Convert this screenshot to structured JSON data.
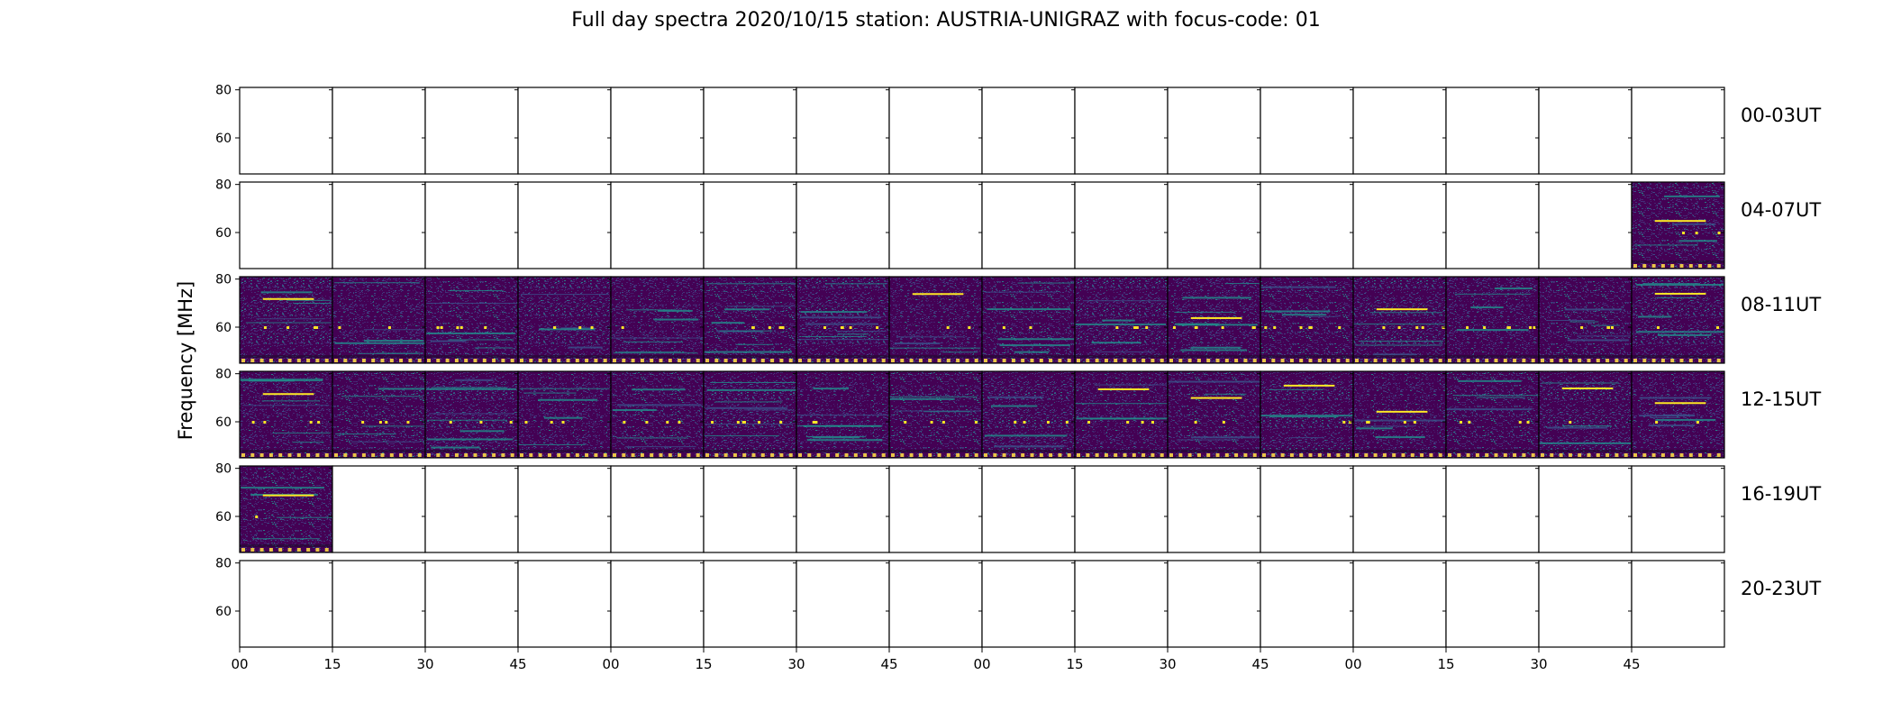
{
  "title": "Full day spectra 2020/10/15 station: AUSTRIA-UNIGRAZ with focus-code: 01",
  "colors": {
    "background": "#440154",
    "mid": "#3b528b",
    "teal": "#21918c",
    "bright": "#fde725",
    "axis": "#000000"
  },
  "chart_data": {
    "type": "heatmap",
    "ylabel": "Frequency [MHz]",
    "yticks": [
      80,
      60
    ],
    "ylim": [
      45,
      81
    ],
    "xticks": [
      "00",
      "15",
      "30",
      "45",
      "00",
      "15",
      "30",
      "45",
      "00",
      "15",
      "30",
      "45",
      "00",
      "15",
      "30",
      "45"
    ],
    "panels_per_row": 16,
    "minutes_per_panel": 15,
    "rows": [
      {
        "label": "00-03UT",
        "filled": []
      },
      {
        "label": "04-07UT",
        "filled": [
          15
        ]
      },
      {
        "label": "08-11UT",
        "filled": [
          0,
          1,
          2,
          3,
          4,
          5,
          6,
          7,
          8,
          9,
          10,
          11,
          12,
          13,
          14,
          15
        ]
      },
      {
        "label": "12-15UT",
        "filled": [
          0,
          1,
          2,
          3,
          4,
          5,
          6,
          7,
          8,
          9,
          10,
          11,
          12,
          13,
          14,
          15
        ]
      },
      {
        "label": "16-19UT",
        "filled": [
          0
        ]
      },
      {
        "label": "20-23UT",
        "filled": []
      }
    ],
    "colormap": "viridis",
    "grid": false
  }
}
